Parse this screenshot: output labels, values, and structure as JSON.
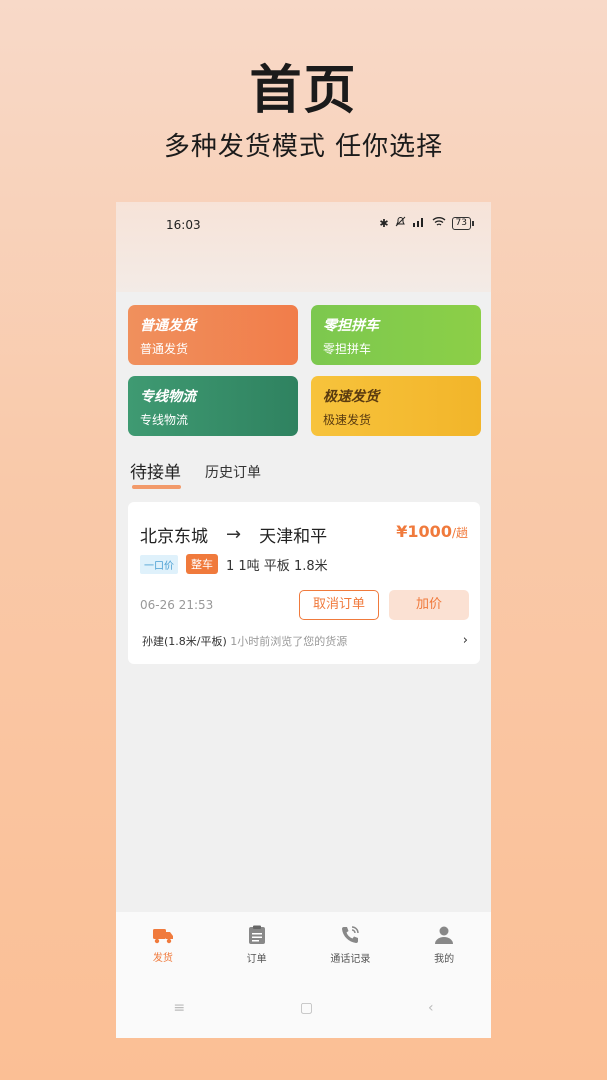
{
  "promo": {
    "title": "首页",
    "subtitle": "多种发货模式 任你选择"
  },
  "status_bar": {
    "time": "16:03",
    "battery": "73"
  },
  "tiles": [
    {
      "title": "普通发货",
      "subtitle": "普通发货"
    },
    {
      "title": "零担拼车",
      "subtitle": "零担拼车"
    },
    {
      "title": "专线物流",
      "subtitle": "专线物流"
    },
    {
      "title": "极速发货",
      "subtitle": "极速发货"
    }
  ],
  "tabs": {
    "active": "待接单",
    "other": "历史订单"
  },
  "order": {
    "from": "北京东城",
    "arrow": "→",
    "to": "天津和平",
    "price": "¥1000",
    "price_unit": "/趟",
    "tag_price": "一口价",
    "tag_vehicle": "整车",
    "specs": "1 1吨 平板 1.8米",
    "datetime": "06-26 21:53",
    "cancel_label": "取消订单",
    "raise_label": "加价",
    "viewer": "孙建(1.8米/平板)",
    "viewer_note": "1小时前浏览了您的货源",
    "chevron": "›"
  },
  "bottom_nav": [
    {
      "label": "发货",
      "icon": "truck-icon",
      "active": true
    },
    {
      "label": "订单",
      "icon": "clipboard-icon",
      "active": false
    },
    {
      "label": "通话记录",
      "icon": "phone-icon",
      "active": false
    },
    {
      "label": "我的",
      "icon": "user-icon",
      "active": false
    }
  ],
  "system_nav": {
    "menu": "≡",
    "home": "▢",
    "back": "‹"
  },
  "colors": {
    "accent": "#f07a3c",
    "tile_1": "#f17d4a",
    "tile_2": "#8ccf47",
    "tile_3": "#2f8260",
    "tile_4": "#f2b52a"
  }
}
